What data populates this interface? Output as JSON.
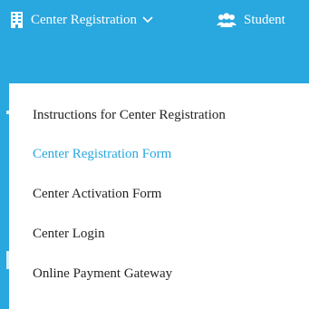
{
  "colors": {
    "brand_blue": "#29a7df",
    "menu_text": "#222222",
    "menu_active": "#29a7df",
    "nav_text": "#ffffff"
  },
  "navbar": {
    "items": [
      {
        "label": "Center Registration",
        "icon": "building-icon",
        "has_dropdown": true
      },
      {
        "label": "Student",
        "icon": "users-icon",
        "has_dropdown": false
      }
    ]
  },
  "dropdown": {
    "items": [
      {
        "label": "Instructions for Center Registration",
        "active": false
      },
      {
        "label": "Center Registration Form",
        "active": true
      },
      {
        "label": "Center Activation Form",
        "active": false
      },
      {
        "label": "Center Login",
        "active": false
      },
      {
        "label": "Online Payment Gateway",
        "active": false
      }
    ]
  }
}
